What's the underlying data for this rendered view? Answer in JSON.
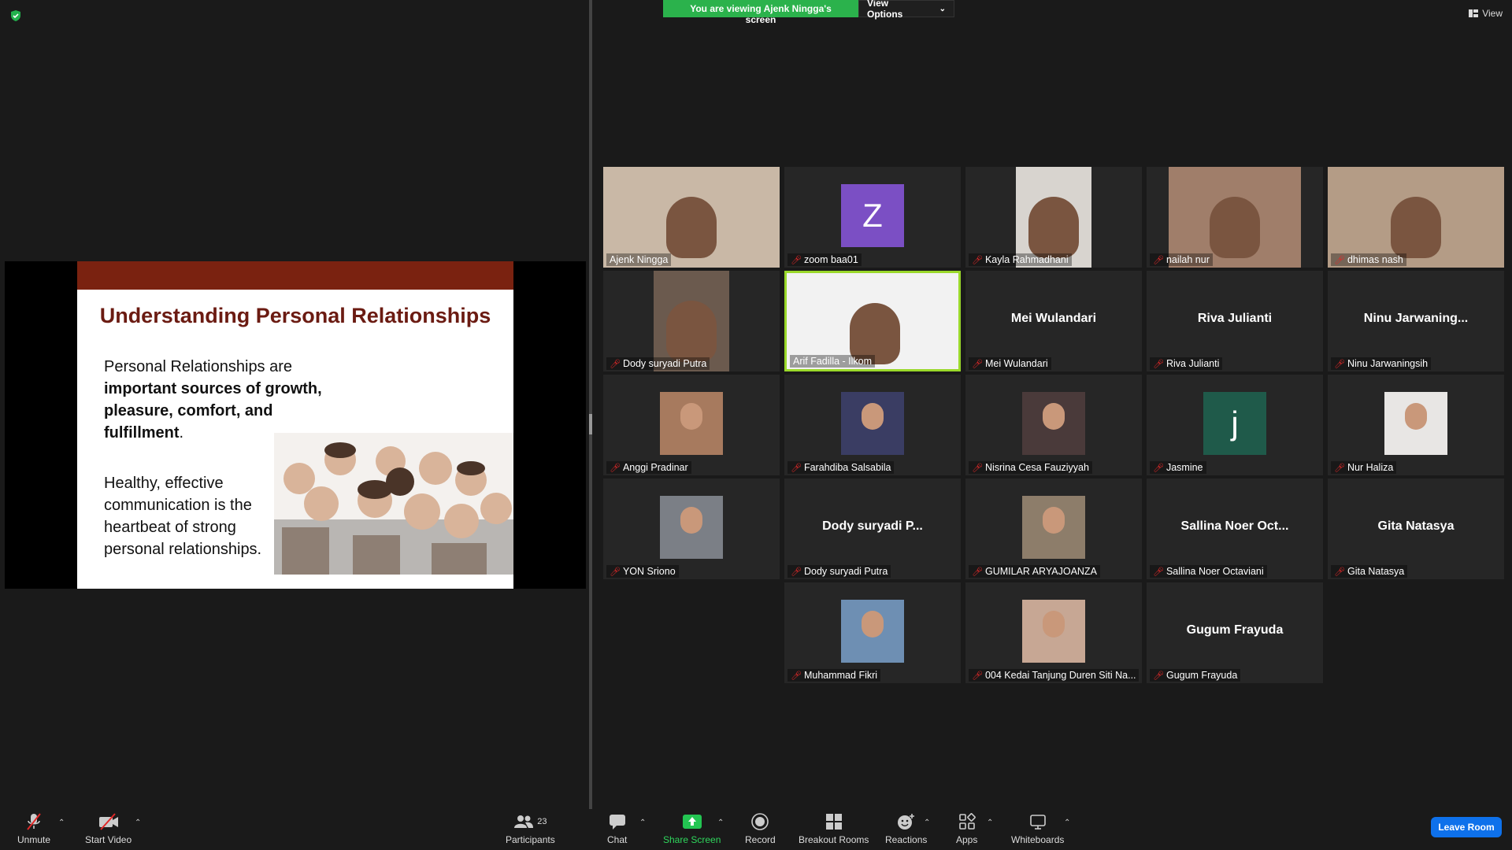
{
  "banner": {
    "viewing": "You are viewing Ajenk Ningga's screen",
    "view_options": "View Options"
  },
  "view_top": "View",
  "slide": {
    "title": "Understanding Personal Relationships",
    "p1_a": "Personal Relationships are ",
    "p1_b": "important sources of growth, pleasure, comfort, and fulfillment",
    "p1_c": ".",
    "p2": "Healthy, effective communication is the heartbeat of strong personal relationships."
  },
  "tiles": [
    {
      "label": "Ajenk Ningga",
      "muted": false,
      "kind": "video",
      "color": "#c9b8a6"
    },
    {
      "label": "zoom baa01",
      "muted": true,
      "kind": "letter",
      "letter": "Z",
      "color": "#7b4fc4"
    },
    {
      "label": "Kayla Rahmadhani",
      "muted": true,
      "kind": "video",
      "color": "#d8d4cf"
    },
    {
      "label": "nailah nur",
      "muted": true,
      "kind": "video",
      "color": "#a07e6a"
    },
    {
      "label": "dhimas nash",
      "muted": true,
      "kind": "video",
      "color": "#b49c86"
    },
    {
      "label": "Dody suryadi Putra",
      "muted": true,
      "kind": "video",
      "color": "#6b5a4e"
    },
    {
      "label": "Arif Fadilla - Ilkom",
      "muted": false,
      "kind": "video",
      "color": "#f2f2f2",
      "active": true
    },
    {
      "label": "Mei Wulandari",
      "muted": true,
      "kind": "name",
      "center": "Mei Wulandari"
    },
    {
      "label": "Riva Julianti",
      "muted": true,
      "kind": "name",
      "center": "Riva Julianti"
    },
    {
      "label": "Ninu Jarwaningsih",
      "muted": true,
      "kind": "name",
      "center": "Ninu  Jarwaning..."
    },
    {
      "label": "Anggi Pradinar",
      "muted": true,
      "kind": "avatar",
      "color": "#a77a5e"
    },
    {
      "label": "Farahdiba Salsabila",
      "muted": true,
      "kind": "avatar",
      "color": "#3a3d63"
    },
    {
      "label": "Nisrina Cesa Fauziyyah",
      "muted": true,
      "kind": "avatar",
      "color": "#4a3a3a"
    },
    {
      "label": "Jasmine",
      "muted": true,
      "kind": "letter",
      "letter": "j",
      "color": "#1f5a4a"
    },
    {
      "label": "Nur Haliza",
      "muted": true,
      "kind": "avatar",
      "color": "#e8e6e4"
    },
    {
      "label": "YON Sriono",
      "muted": true,
      "kind": "avatar",
      "color": "#7b7f86"
    },
    {
      "label": "Dody suryadi Putra",
      "muted": true,
      "kind": "name",
      "center": "Dody  suryadi  P..."
    },
    {
      "label": "GUMILAR ARYAJOANZA",
      "muted": true,
      "kind": "avatar",
      "color": "#8d7d6a"
    },
    {
      "label": "Sallina Noer Octaviani",
      "muted": true,
      "kind": "name",
      "center": "Sallina  Noer  Oct..."
    },
    {
      "label": "Gita Natasya",
      "muted": true,
      "kind": "name",
      "center": "Gita Natasya"
    },
    {
      "label": "Muhammad Fikri",
      "muted": true,
      "kind": "avatar",
      "color": "#6e8fb3"
    },
    {
      "label": "004 Kedai Tanjung Duren Siti Na...",
      "muted": true,
      "kind": "avatar",
      "color": "#c7a794"
    },
    {
      "label": "Gugum Frayuda",
      "muted": true,
      "kind": "name",
      "center": "Gugum Frayuda"
    }
  ],
  "toolbar": {
    "unmute": "Unmute",
    "start_video": "Start Video",
    "participants": "Participants",
    "participant_count": "23",
    "chat": "Chat",
    "share_screen": "Share Screen",
    "record": "Record",
    "breakout": "Breakout Rooms",
    "reactions": "Reactions",
    "apps": "Apps",
    "whiteboards": "Whiteboards",
    "leave": "Leave Room"
  }
}
